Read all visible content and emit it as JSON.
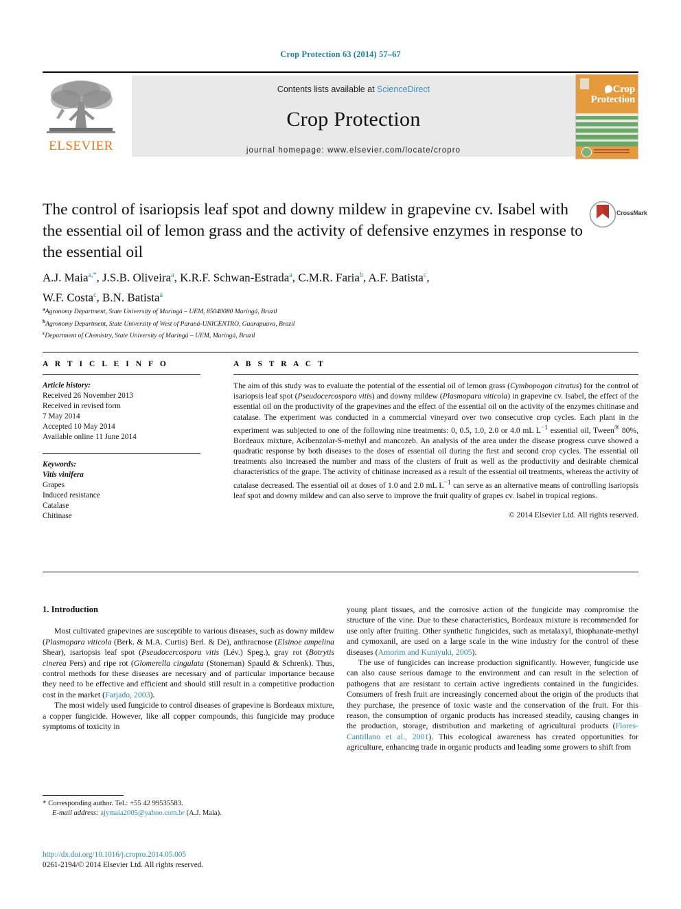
{
  "running_head": "Crop Protection 63 (2014) 57–67",
  "banner": {
    "publisher_name": "ELSEVIER",
    "publisher_logo_icon": "elsevier-tree-icon",
    "contents_prefix": "Contents lists available at ",
    "contents_link": "ScienceDirect",
    "journal_title": "Crop Protection",
    "homepage": "journal homepage: www.elsevier.com/locate/cropro",
    "cover": {
      "title_line1": "Crop",
      "title_line2": "Protection",
      "leaf_icon": "leaf-icon",
      "mini_logo_icon": "elsevier-mini-logo-icon",
      "globe_icon": "globe-icon",
      "bg_color": "#e59a3c",
      "stripe_color": "#6aa76b"
    }
  },
  "article": {
    "title": "The control of isariopsis leaf spot and downy mildew in grapevine cv. Isabel with the essential oil of lemon grass and the activity of defensive enzymes in response to the essential oil",
    "crossmark": {
      "label": "CrossMark",
      "icon": "crossmark-icon"
    },
    "authors_line1": "A.J. Maia<sup>a,*</sup>, J.S.B. Oliveira<sup>a</sup>, K.R.F. Schwan-Estrada<sup>a</sup>, C.M.R. Faria<sup>b</sup>, A.F. Batista<sup>c</sup>,",
    "authors_line2": "W.F. Costa<sup>c</sup>, B.N. Batista<sup>a</sup>",
    "affiliations": [
      {
        "marker": "a",
        "text": "Agronomy Department, State University of Maringá – UEM, 85040080 Maringá, Brazil"
      },
      {
        "marker": "b",
        "text": "Agronomy Department, State University of West of Paraná-UNICENTRO, Guarapuava, Brazil"
      },
      {
        "marker": "c",
        "text": "Department of Chemistry, State University of Maringá – UEM, Maringá, Brazil"
      }
    ]
  },
  "article_info": {
    "heading": "A R T I C L E   I N F O",
    "history_label": "Article history:",
    "history": [
      "Received 26 November 2013",
      "Received in revised form",
      "7 May 2014",
      "Accepted 10 May 2014",
      "Available online 11 June 2014"
    ],
    "keywords_label": "Keywords:",
    "keywords": [
      "Vitis vinifera",
      "Grapes",
      "Induced resistance",
      "Catalase",
      "Chitinase"
    ],
    "keywords_italic_index": 0
  },
  "abstract": {
    "heading": "A B S T R A C T",
    "text_html": "The aim of this study was to evaluate the potential of the essential oil of lemon grass (<i>Cymbopogon citratus</i>) for the control of isariopsis leaf spot (<i>Pseudocercospora vitis</i>) and downy mildew (<i>Plasmopara viticola</i>) in grapevine cv. Isabel, the effect of the essential oil on the productivity of the grapevines and the effect of the essential oil on the activity of the enzymes chitinase and catalase. The experiment was conducted in a commercial vineyard over two consecutive crop cycles. Each plant in the experiment was subjected to one of the following nine treatments: 0, 0.5, 1.0, 2.0 or 4.0 mL L<sup>−1</sup> essential oil, Tween<sup>®</sup> 80%, Bordeaux mixture, Acibenzolar-S-methyl and mancozeb. An analysis of the area under the disease progress curve showed a quadratic response by both diseases to the doses of essential oil during the first and second crop cycles. The essential oil treatments also increased the number and mass of the clusters of fruit as well as the productivity and desirable chemical characteristics of the grape. The activity of chitinase increased as a result of the essential oil treatments, whereas the activity of catalase decreased. The essential oil at doses of 1.0 and 2.0 mL L<sup>−1</sup> can serve as an alternative means of controlling isariopsis leaf spot and downy mildew and can also serve to improve the fruit quality of grapes cv. Isabel in tropical regions.",
    "copyright": "© 2014 Elsevier Ltd. All rights reserved."
  },
  "introduction": {
    "heading": "1. Introduction",
    "left_paragraphs_html": [
      "Most cultivated grapevines are susceptible to various diseases, such as downy mildew (<i>Plasmopara viticola</i> (Berk. &amp; M.A. Curtis) Berl. &amp; De), anthracnose (<i>Elsinoe ampelina</i> Shear), isariopsis leaf spot (<i>Pseudocercospora vitis</i> (Lév.) Speg.), gray rot (<i>Botrytis cinerea</i> Pers) and ripe rot (<i>Glomerella cingulata</i> (Stoneman) Spauld &amp; Schrenk). Thus, control methods for these diseases are necessary and of particular importance because they need to be effective and efficient and should still result in a competitive production cost in the market (<span class=\"ref\">Farjado, 2003</span>).",
      "The most widely used fungicide to control diseases of grapevine is Bordeaux mixture, a copper fungicide. However, like all copper compounds, this fungicide may produce symptoms of toxicity in"
    ],
    "right_paragraphs_html": [
      "young plant tissues, and the corrosive action of the fungicide may compromise the structure of the vine. Due to these characteristics, Bordeaux mixture is recommended for use only after fruiting. Other synthetic fungicides, such as metalaxyl, thiophanate-methyl and cymoxanil, are used on a large scale in the wine industry for the control of these diseases (<span class=\"ref\">Amorim and Kuniyuki, 2005</span>).",
      "The use of fungicides can increase production significantly. However, fungicide use can also cause serious damage to the environment and can result in the selection of pathogens that are resistant to certain active ingredients contained in the fungicides. Consumers of fresh fruit are increasingly concerned about the origin of the products that they purchase, the presence of toxic waste and the conservation of the fruit. For this reason, the consumption of organic products has increased steadily, causing changes in the production, storage, distribution and marketing of agricultural products (<span class=\"ref\">Flores-Cantillano et al., 2001</span>). This ecological awareness has created opportunities for agriculture, enhancing trade in organic products and leading some growers to shift from"
    ]
  },
  "footer": {
    "corresponding_marker": "*",
    "corresponding_text": "Corresponding author. Tel.: +55 42 99535583.",
    "email_label": "E-mail address:",
    "email": "ajymaia2005@yahoo.com.br",
    "email_suffix": "(A.J. Maia).",
    "doi": "http://dx.doi.org/10.1016/j.cropro.2014.05.005",
    "issn_line": "0261-2194/© 2014 Elsevier Ltd. All rights reserved."
  },
  "colors": {
    "link": "#2a87b0",
    "elsevier_orange": "#E87722",
    "cover_orange": "#e59a3c",
    "cover_green": "#6aa76b",
    "banner_grey": "#e9e9e9"
  }
}
